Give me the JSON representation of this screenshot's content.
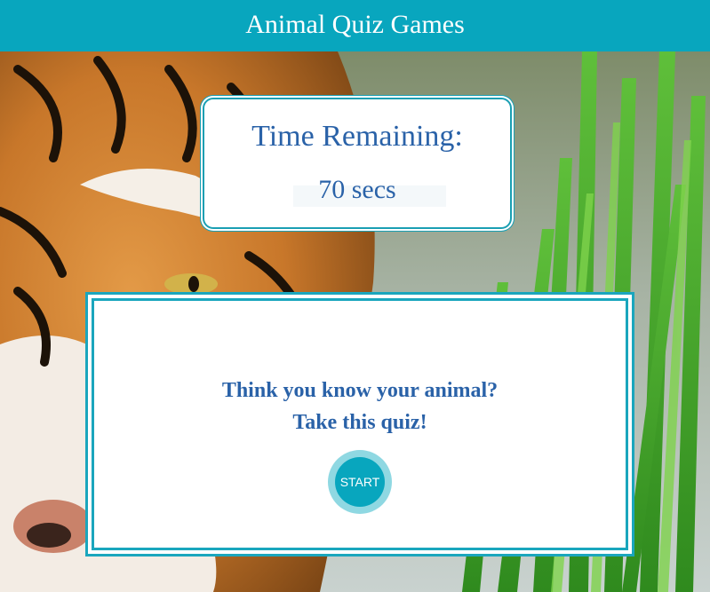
{
  "header": {
    "title": "Animal Quiz Games"
  },
  "background": {
    "subject": "tiger-photo"
  },
  "timer": {
    "label": "Time Remaining:",
    "value": "70 secs"
  },
  "quiz": {
    "line1": "Think you know your animal?",
    "line2": "Take this quiz!",
    "start_label": "START"
  },
  "colors": {
    "accent": "#08a6be",
    "text": "#2a62a8",
    "start_ring": "#8fd8e2"
  }
}
